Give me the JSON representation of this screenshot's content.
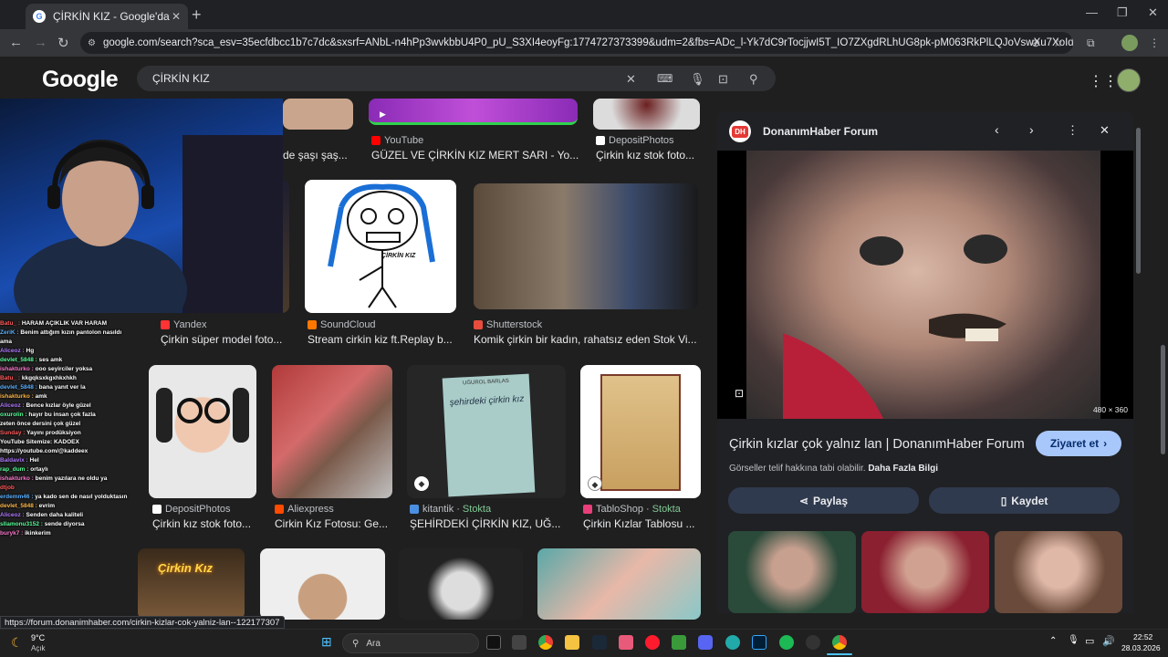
{
  "browser": {
    "tab_title": "ÇİRKİN KIZ - Google'da Ara",
    "tab_favicon": "G",
    "new_tab": "+",
    "url": "google.com/search?sca_esv=35ecfdbcc1b7c7dc&sxsrf=ANbL-n4hPp3wvkbbU4P0_pU_S3XI4eoyFg:1774727373399&udm=2&fbs=ADc_l-Yk7dC9rTocjjwI5T_IO7ZXgdRLhUG8pk-pM063RkPlLQJoVswXu7XoIdd5UH6fMIoUD...",
    "controls": {
      "minimize": "—",
      "maximize": "❐",
      "close": "✕"
    }
  },
  "google": {
    "logo": "Google",
    "query": "ÇİRKİN KIZ"
  },
  "results": {
    "row1": [
      {
        "source": "",
        "caption": "de şaşı şaş..."
      },
      {
        "source": "YouTube",
        "caption": "GÜZEL VE ÇİRKİN KIZ MERT SARI - Yo..."
      },
      {
        "source": "DepositPhotos",
        "caption": "Çirkin kız stok foto..."
      }
    ],
    "row2": [
      {
        "source": "Yandex",
        "caption": "Çirkin süper model foto..."
      },
      {
        "source": "SoundCloud",
        "caption": "Stream cirkin kiz ft.Replay b..."
      },
      {
        "source": "Shutterstock",
        "caption": "Komik çirkin bir kadın, rahatsız eden Stok Vi..."
      }
    ],
    "row2_drawing_text": "ÇİRKİN KIZ",
    "row3": [
      {
        "source": "DepositPhotos",
        "extra": "",
        "caption": "Çirkin kız stok foto..."
      },
      {
        "source": "Aliexpress",
        "extra": "",
        "caption": "Cirkin Kız Fotosu: Ge..."
      },
      {
        "source": "kitantik",
        "extra": "Stokta",
        "caption": "ŞEHİRDEKİ ÇİRKİN KIZ, UĞ..."
      },
      {
        "source": "TabloShop",
        "extra": "Stokta",
        "caption": "Çirkin Kızlar Tablosu ..."
      }
    ],
    "book_title": "şehirdeki çirkin kız",
    "book_author": "UĞUROL BARLAS",
    "row4_sign": "Çirkin Kız"
  },
  "chat": [
    {
      "user": "Batu_",
      "msg": "HARAM AÇIKLIK VAR HARAM"
    },
    {
      "user": "ZeriK",
      "msg": "Benim attığım kızın pantolon nasıldı"
    },
    {
      "user": "",
      "msg": "ama"
    },
    {
      "user": "Aliceoz",
      "msg": "Hg"
    },
    {
      "user": "devlet_5848",
      "msg": "ses amk"
    },
    {
      "user": "ishakturko",
      "msg": "ooo seyirciler yoksa"
    },
    {
      "user": "Batu_",
      "msg": "kkgqksxkgxhkxhkh"
    },
    {
      "user": "devlet_5848",
      "msg": "bana yanıt ver la"
    },
    {
      "user": "ishakturko",
      "msg": "amk"
    },
    {
      "user": "Aliceoz",
      "msg": "Bence kızlar öyle güzel"
    },
    {
      "user": "oxurolin",
      "msg": "hayır bu insan çok fazla"
    },
    {
      "user": "",
      "msg": "zeten önce dersini çok güzel"
    },
    {
      "user": "Sunday",
      "msg": "Yayını prodüksiyon"
    },
    {
      "user": "",
      "msg": "YouTube Sitemize: KADOEX"
    },
    {
      "user": "",
      "msg": "https://youtube.com/@kaddeex"
    },
    {
      "user": "Baldavix",
      "msg": "Hel"
    },
    {
      "user": "rap_dum",
      "msg": "ortaylı"
    },
    {
      "user": "ishakturko",
      "msg": "benim yazılara ne oldu ya"
    },
    {
      "user": "dtjob",
      "msg": ""
    },
    {
      "user": "erdemm46",
      "msg": "ya kado sen de nasıl yolduktasın"
    },
    {
      "user": "devlet_5848",
      "msg": "evrim"
    },
    {
      "user": "Aliceoz",
      "msg": "Senden daha kaliteli"
    },
    {
      "user": "sllamonu3152",
      "msg": "sende diyorsa"
    },
    {
      "user": "buryk7",
      "msg": "ikinkerim"
    }
  ],
  "panel": {
    "site_logo": "DH",
    "site_name": "DonanımHaber Forum",
    "image_size": "480 × 360",
    "title": "Çirkin kızlar çok yalnız lan | DonanımHaber Forum",
    "visit_button": "Ziyaret et",
    "copyright": "Görseller telif hakkına tabi olabilir.",
    "more_info": "Daha Fazla Bilgi",
    "share_button": "Paylaş",
    "save_button": "Kaydet"
  },
  "status_url": "https://forum.donanimhaber.com/cirkin-kizlar-cok-yalniz-lan--122177307",
  "taskbar": {
    "weather_temp": "9°C",
    "weather_desc": "Açık",
    "search_placeholder": "Ara",
    "time": "22:52",
    "date": "28.03.2026"
  },
  "colors": {
    "background": "#1f1f1f",
    "visit_button": "#a8c7fa",
    "stokta": "#81c995"
  }
}
